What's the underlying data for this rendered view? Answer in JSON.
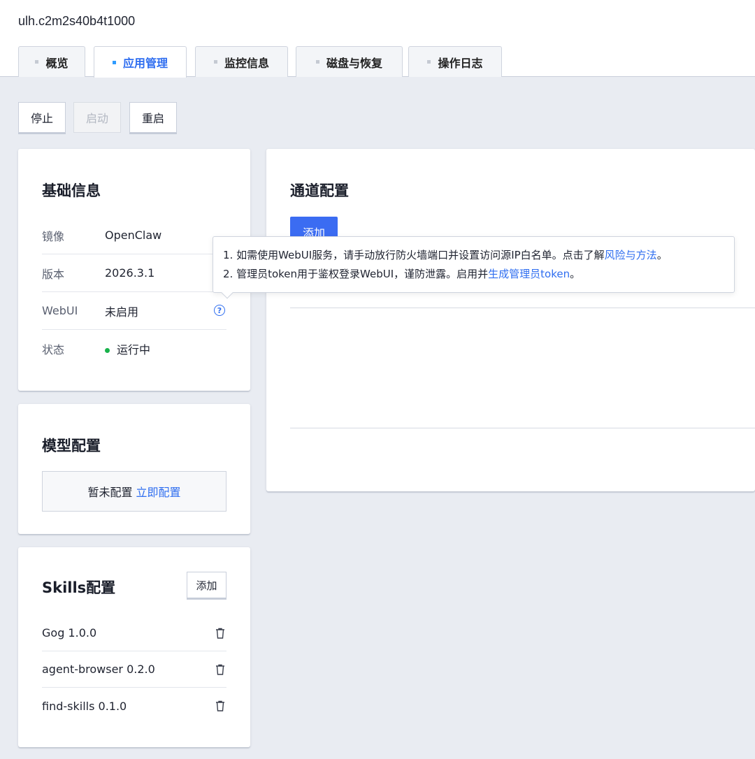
{
  "instance_id": "ulh.c2m2s40b4t1000",
  "tabs": [
    {
      "label": "概览"
    },
    {
      "label": "应用管理"
    },
    {
      "label": "监控信息"
    },
    {
      "label": "磁盘与恢复"
    },
    {
      "label": "操作日志"
    }
  ],
  "active_tab": "应用管理",
  "actions": {
    "stop": "停止",
    "start": "启动",
    "restart": "重启"
  },
  "basic_info": {
    "title": "基础信息",
    "rows": [
      {
        "key": "镜像",
        "value": "OpenClaw"
      },
      {
        "key": "版本",
        "value": "2026.3.1"
      },
      {
        "key": "WebUI",
        "value": "未启用"
      },
      {
        "key": "状态",
        "value": "运行中"
      }
    ],
    "help_icon": "?"
  },
  "model_config": {
    "title": "模型配置",
    "empty_text": "暂未配置",
    "action_link": "立即配置"
  },
  "skills_config": {
    "title": "Skills配置",
    "add_label": "添加",
    "items": [
      {
        "name": "Gog 1.0.0"
      },
      {
        "name": "agent-browser 0.2.0"
      },
      {
        "name": "find-skills 0.1.0"
      }
    ]
  },
  "channel_config": {
    "title": "通道配置",
    "add_label": "添加"
  },
  "tooltip": {
    "line1_text": "1. 如需使用WebUI服务，请手动放行防火墙端口并设置访问源IP白名单。点击了解",
    "line1_link": "风险与方法",
    "line1_end": "。",
    "line2_text": "2. 管理员token用于鉴权登录WebUI，谨防泄露。启用并",
    "line2_link": "生成管理员token",
    "line2_end": "。"
  },
  "colors": {
    "accent": "#2f6ef0",
    "primary_button": "#3b6cf2",
    "status_running": "#18b24b",
    "page_bg": "#e9ecf2"
  }
}
